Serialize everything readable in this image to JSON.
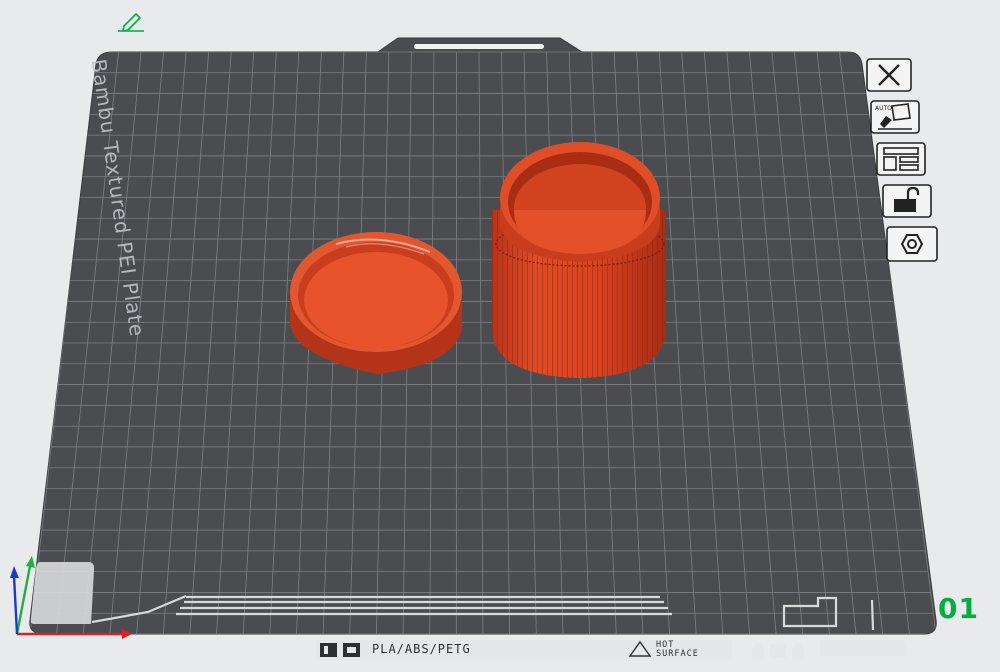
{
  "plate": {
    "name": "Bambu Textured PEI Plate",
    "number": "01",
    "filament_types": "PLA/ABS/PETG",
    "hot_surface_line1": "HOT",
    "hot_surface_line2": "SURFACE"
  },
  "colors": {
    "plate": "#4a4c4f",
    "grid": "#8f9296",
    "part": "#d9431f",
    "accent": "#00ae42",
    "background": "#e9eaec"
  },
  "toolbar": {
    "edit": "pencil-icon",
    "tools": [
      {
        "name": "delete-plate",
        "icon": "close-icon"
      },
      {
        "name": "auto-orient",
        "icon": "auto-orient-icon"
      },
      {
        "name": "arrange",
        "icon": "arrange-icon"
      },
      {
        "name": "lock-plate",
        "icon": "unlock-icon"
      },
      {
        "name": "plate-settings",
        "icon": "settings-hex-icon"
      }
    ]
  },
  "objects": [
    {
      "name": "jar-lid"
    },
    {
      "name": "jar-body"
    }
  ],
  "axes": {
    "x_color": "#e02020",
    "y_color": "#20b040",
    "z_color": "#1a3ad0"
  }
}
